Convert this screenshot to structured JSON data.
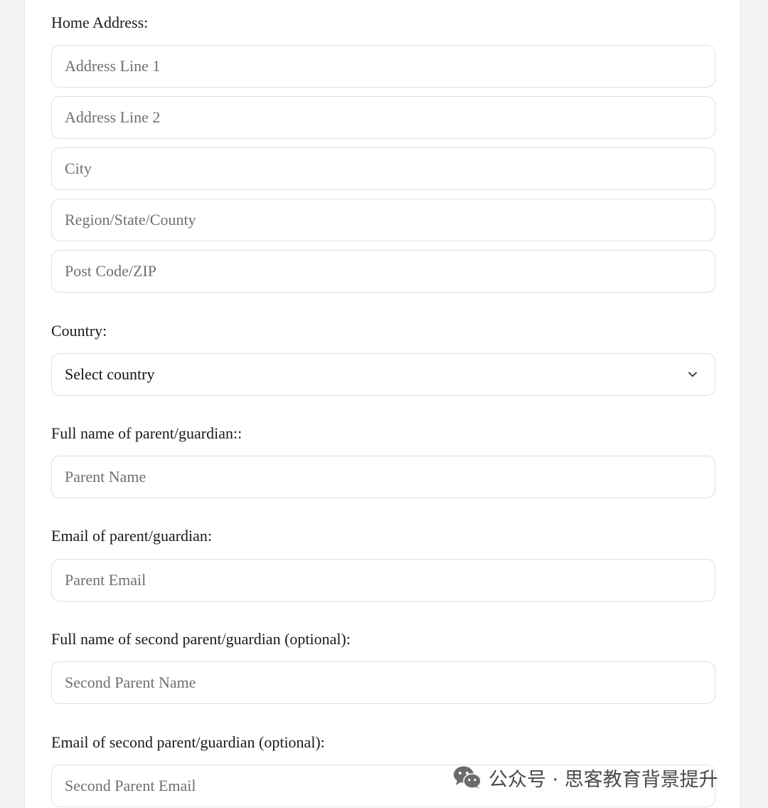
{
  "form": {
    "home_address_label": "Home Address:",
    "address_line1_placeholder": "Address Line 1",
    "address_line2_placeholder": "Address Line 2",
    "city_placeholder": "City",
    "region_placeholder": "Region/State/County",
    "postcode_placeholder": "Post Code/ZIP",
    "country_label": "Country:",
    "country_select_value": "Select country",
    "parent_name_label": "Full name of parent/guardian::",
    "parent_name_placeholder": "Parent Name",
    "parent_email_label": "Email of parent/guardian:",
    "parent_email_placeholder": "Parent Email",
    "second_parent_name_label": "Full name of second parent/guardian (optional):",
    "second_parent_name_placeholder": "Second Parent Name",
    "second_parent_email_label": "Email of second parent/guardian (optional):",
    "second_parent_email_placeholder": "Second Parent Email"
  },
  "icons": {
    "select_arrow": "chevron-down-icon",
    "watermark_logo": "wechat-icon"
  },
  "watermark": {
    "text": "公众号 · 思客教育背景提升"
  },
  "colors": {
    "border": "#dedee2",
    "placeholder": "#6f6f76",
    "background": "#f4f4f5",
    "card": "#ffffff"
  }
}
